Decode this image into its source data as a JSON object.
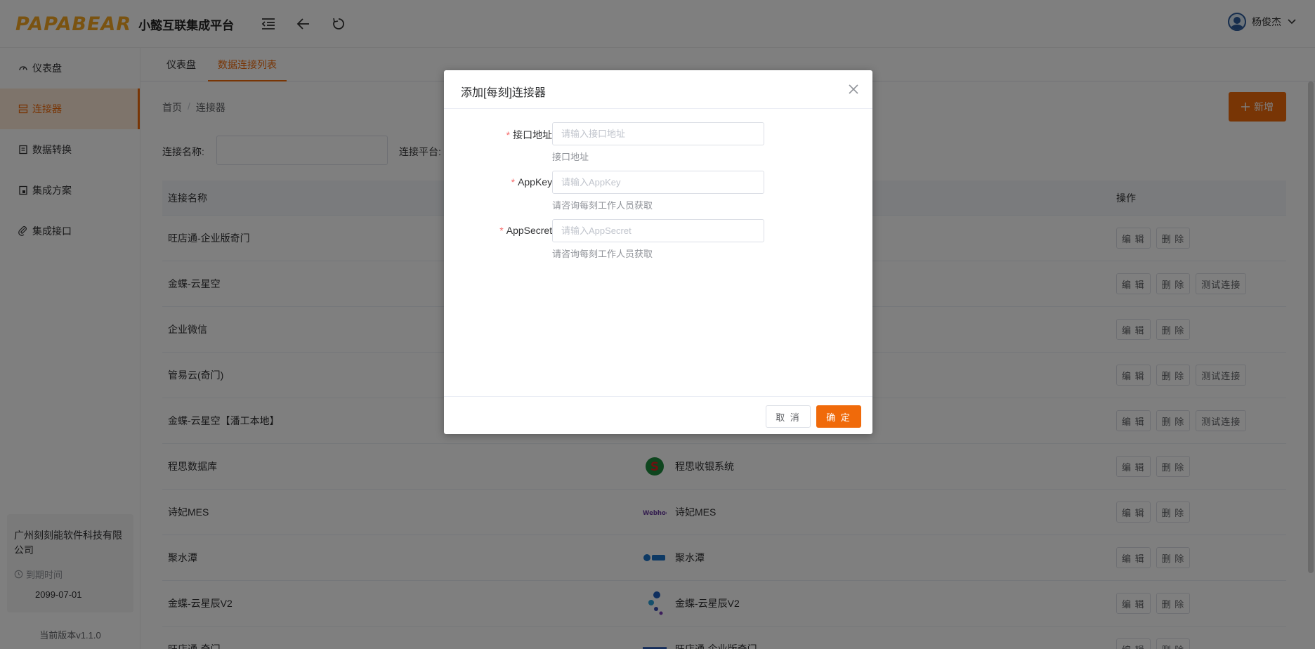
{
  "header": {
    "logo_text": "PAPABEAR",
    "platform_name": "小懿互联集成平台",
    "username": "杨俊杰"
  },
  "sidebar": {
    "items": [
      {
        "label": "仪表盘",
        "icon": "dashboard-icon"
      },
      {
        "label": "连接器",
        "icon": "connector-icon"
      },
      {
        "label": "数据转换",
        "icon": "transform-icon"
      },
      {
        "label": "集成方案",
        "icon": "scheme-icon"
      },
      {
        "label": "集成接口",
        "icon": "link-icon"
      }
    ],
    "company": "广州刻刻能软件科技有限公司",
    "expire_label": "到期时间",
    "expire_date": "2099-07-01",
    "version": "当前版本v1.1.0"
  },
  "tabs": [
    "仪表盘",
    "数据连接列表"
  ],
  "breadcrumb": [
    "首页",
    "连接器"
  ],
  "add_button": "新增",
  "filters": {
    "name_label": "连接名称:",
    "platform_label": "连接平台:"
  },
  "table": {
    "headers": {
      "name": "连接名称",
      "ops": "操作"
    },
    "rows": [
      {
        "name": "旺店通-企业版奇门",
        "platform": "",
        "ops": [
          "编 辑",
          "删 除"
        ]
      },
      {
        "name": "金蝶-云星空",
        "platform": "",
        "ops": [
          "编 辑",
          "删 除",
          "测试连接"
        ]
      },
      {
        "name": "企业微信",
        "platform": "",
        "ops": [
          "编 辑",
          "删 除"
        ]
      },
      {
        "name": "管易云(奇门)",
        "platform": "",
        "ops": [
          "编 辑",
          "删 除",
          "测试连接"
        ]
      },
      {
        "name": "金蝶-云星空【潘工本地】",
        "platform": "",
        "ops": [
          "编 辑",
          "删 除",
          "测试连接"
        ]
      },
      {
        "name": "程思数据库",
        "platform": "程思收银系统",
        "logo": "chengsi",
        "ops": [
          "编 辑",
          "删 除"
        ]
      },
      {
        "name": "诗妃MES",
        "platform": "诗妃MES",
        "logo": "webhook",
        "ops": [
          "编 辑",
          "删 除"
        ]
      },
      {
        "name": "聚水潭",
        "platform": "聚水潭",
        "logo": "jushuitan",
        "ops": [
          "编 辑",
          "删 除"
        ]
      },
      {
        "name": "金蝶-云星辰V2",
        "platform": "金蝶-云星辰V2",
        "logo": "kingdee",
        "ops": [
          "编 辑",
          "删 除"
        ]
      },
      {
        "name": "旺店通-奇门",
        "platform": "旺店通-企业版奇门",
        "logo": "wdt",
        "ops": [
          "编 辑",
          "删 除"
        ]
      }
    ]
  },
  "dialog": {
    "title": "添加[每刻]连接器",
    "fields": [
      {
        "label": "接口地址:",
        "placeholder": "请输入接口地址",
        "hint": "接口地址"
      },
      {
        "label": "AppKey:",
        "placeholder": "请输入AppKey",
        "hint": "请咨询每刻工作人员获取"
      },
      {
        "label": "AppSecret:",
        "placeholder": "请输入AppSecret",
        "hint": "请咨询每刻工作人员获取"
      }
    ],
    "cancel": "取 消",
    "confirm": "确 定"
  },
  "colors": {
    "accent": "#f06a0a",
    "logo": "#f5a623"
  }
}
